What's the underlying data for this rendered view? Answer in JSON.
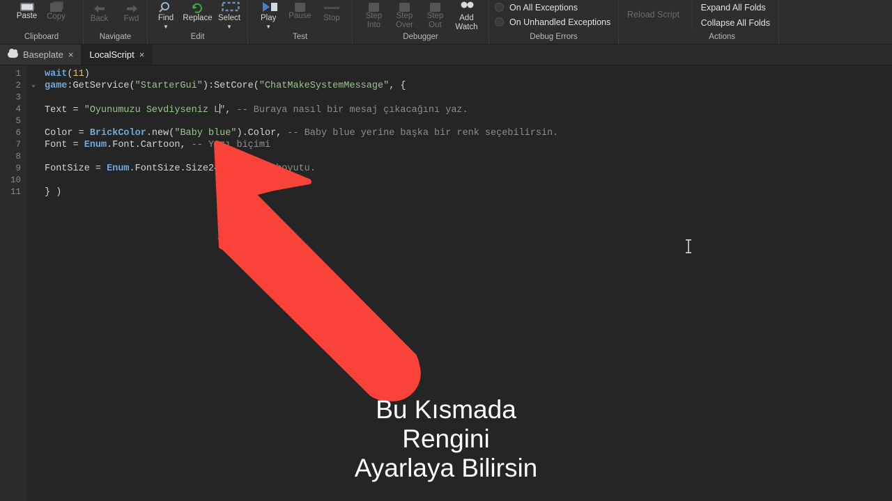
{
  "ribbon": {
    "groups": [
      {
        "title": "Clipboard",
        "buttons": [
          {
            "label": "Paste",
            "icon": "paste-icon",
            "disabled": false
          },
          {
            "label": "Copy",
            "icon": "copy-icon",
            "disabled": true
          }
        ]
      },
      {
        "title": "Navigate",
        "buttons": [
          {
            "label": "Back",
            "icon": "arrow-left-icon",
            "disabled": true
          },
          {
            "label": "Fwd",
            "icon": "arrow-right-icon",
            "disabled": true
          }
        ]
      },
      {
        "title": "Edit",
        "buttons": [
          {
            "label": "Find",
            "icon": "magnifier-icon",
            "disabled": false,
            "caret": true
          },
          {
            "label": "Replace",
            "icon": "replace-icon",
            "disabled": false
          },
          {
            "label": "Select",
            "icon": "select-dashed-icon",
            "disabled": false,
            "caret": true
          }
        ]
      },
      {
        "title": "Test",
        "buttons": [
          {
            "label": "Play",
            "icon": "play-icon",
            "disabled": false,
            "caret": true
          },
          {
            "label": "Pause",
            "icon": "pause-icon",
            "disabled": true
          },
          {
            "label": "Stop",
            "icon": "stop-icon",
            "disabled": true
          }
        ]
      },
      {
        "title": "Debugger",
        "buttons": [
          {
            "label": "Step\nInto",
            "icon": "step-into-icon",
            "disabled": true
          },
          {
            "label": "Step\nOver",
            "icon": "step-over-icon",
            "disabled": true
          },
          {
            "label": "Step\nOut",
            "icon": "step-out-icon",
            "disabled": true
          },
          {
            "label": "Add\nWatch",
            "icon": "add-watch-icon",
            "disabled": false
          }
        ]
      },
      {
        "title": "Debug Errors",
        "radios": [
          {
            "label": "On All Exceptions",
            "selected": false
          },
          {
            "label": "On Unhandled Exceptions",
            "selected": false
          }
        ]
      },
      {
        "title": "Actions",
        "commands": [
          {
            "label": "Reload Script",
            "disabled": true
          },
          {
            "label": "Expand All Folds",
            "disabled": false
          },
          {
            "label": "Collapse All Folds",
            "disabled": false
          }
        ]
      }
    ]
  },
  "tabs": [
    {
      "label": "Baseplate",
      "icon": "cloud-icon",
      "active": false,
      "close": "×"
    },
    {
      "label": "LocalScript",
      "icon": "",
      "active": true,
      "close": "×"
    }
  ],
  "editor": {
    "lines": [
      {
        "num": "1",
        "fold": "",
        "tokens": [
          {
            "t": "wait",
            "c": "kw"
          },
          {
            "t": "(",
            "c": "plain"
          },
          {
            "t": "11",
            "c": "num"
          },
          {
            "t": ")",
            "c": "plain"
          }
        ]
      },
      {
        "num": "2",
        "fold": "⌄",
        "tokens": [
          {
            "t": "game",
            "c": "kw"
          },
          {
            "t": ":GetService(",
            "c": "plain"
          },
          {
            "t": "\"StarterGui\"",
            "c": "str"
          },
          {
            "t": "):SetCore(",
            "c": "plain"
          },
          {
            "t": "\"ChatMakeSystemMessage\"",
            "c": "str"
          },
          {
            "t": ", {",
            "c": "plain"
          }
        ]
      },
      {
        "num": "3",
        "fold": "",
        "tokens": []
      },
      {
        "num": "4",
        "fold": "",
        "tokens": [
          {
            "t": "Text = ",
            "c": "plain"
          },
          {
            "t": "\"Oyunumuzu Sevdiyseniz L",
            "c": "str"
          },
          {
            "t": "|CARET|",
            "c": "caret"
          },
          {
            "t": "\"",
            "c": "str"
          },
          {
            "t": ", ",
            "c": "plain"
          },
          {
            "t": "-- Buraya nasıl bir mesaj çıkacağını yaz.",
            "c": "com"
          }
        ]
      },
      {
        "num": "5",
        "fold": "",
        "tokens": []
      },
      {
        "num": "6",
        "fold": "",
        "tokens": [
          {
            "t": "Color = ",
            "c": "plain"
          },
          {
            "t": "BrickColor",
            "c": "kw"
          },
          {
            "t": ".new(",
            "c": "plain"
          },
          {
            "t": "\"Baby blue\"",
            "c": "str"
          },
          {
            "t": ").Color, ",
            "c": "plain"
          },
          {
            "t": "-- Baby blue yerine başka bir renk seçebilirsin.",
            "c": "com"
          }
        ]
      },
      {
        "num": "7",
        "fold": "",
        "tokens": [
          {
            "t": "Font = ",
            "c": "plain"
          },
          {
            "t": "Enum",
            "c": "kw"
          },
          {
            "t": ".Font.Cartoon, ",
            "c": "plain"
          },
          {
            "t": "-- Yazı biçimi",
            "c": "com"
          }
        ]
      },
      {
        "num": "8",
        "fold": "",
        "tokens": []
      },
      {
        "num": "9",
        "fold": "",
        "tokens": [
          {
            "t": "FontSize = ",
            "c": "plain"
          },
          {
            "t": "Enum",
            "c": "kw"
          },
          {
            "t": ".FontSize.Size24, ",
            "c": "plain"
          },
          {
            "t": "-- Yazı boyutu.",
            "c": "com"
          }
        ]
      },
      {
        "num": "10",
        "fold": "",
        "tokens": []
      },
      {
        "num": "11",
        "fold": "",
        "tokens": [
          {
            "t": "} )",
            "c": "plain"
          }
        ]
      }
    ]
  },
  "annotation": {
    "arrow_color": "#f9423a",
    "arrow_name": "red-arrow-annotation",
    "caption_lines": [
      "Bu Kısmada",
      "Rengini",
      "Ayarlaya Bilirsin"
    ]
  },
  "colors": {
    "ribbon_bg": "#2e2e2e",
    "editor_bg": "#252525",
    "gutter_bg": "#2b2b2b",
    "accent_red": "#f9423a",
    "string_green": "#96c78a",
    "keyword_blue": "#6fa8dc",
    "comment_gray": "#8c8c8c"
  }
}
